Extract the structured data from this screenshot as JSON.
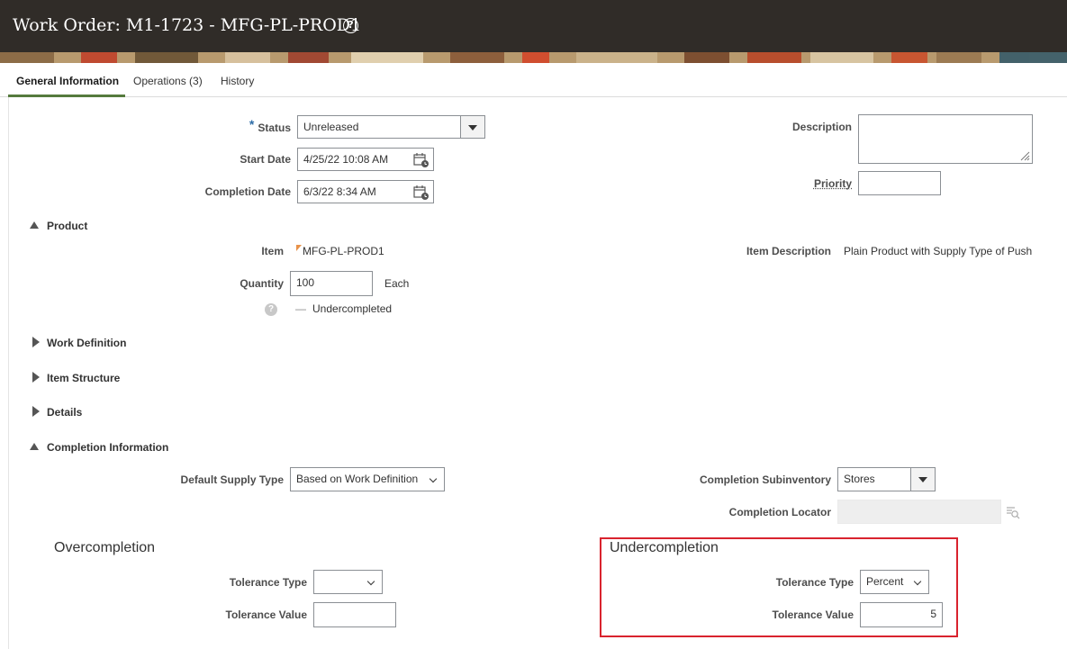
{
  "header": {
    "title": "Work Order: M1-1723 - MFG-PL-PROD1",
    "help_icon": "question-circle-icon"
  },
  "tabs": [
    {
      "label": "General Information",
      "active": true
    },
    {
      "label": "Operations (3)",
      "active": false
    },
    {
      "label": "History",
      "active": false
    }
  ],
  "general": {
    "required_mark": "*",
    "status_label": "Status",
    "status_value": "Unreleased",
    "start_date_label": "Start Date",
    "start_date_value": "4/25/22 10:08 AM",
    "completion_date_label": "Completion Date",
    "completion_date_value": "6/3/22 8:34 AM",
    "description_label": "Description",
    "description_value": "",
    "priority_label": "Priority",
    "priority_value": ""
  },
  "product": {
    "section_label": "Product",
    "item_label": "Item",
    "item_value": "MFG-PL-PROD1",
    "item_description_label": "Item Description",
    "item_description_value": "Plain Product with Supply Type of Push",
    "quantity_label": "Quantity",
    "quantity_value": "100",
    "uom": "Each",
    "undercompleted_dash": "—",
    "undercompleted_label": "Undercompleted"
  },
  "collapsed_sections": [
    "Work Definition",
    "Item Structure",
    "Details"
  ],
  "completion": {
    "section_label": "Completion Information",
    "default_supply_type_label": "Default Supply Type",
    "default_supply_type_value": "Based on Work Definition",
    "completion_subinventory_label": "Completion Subinventory",
    "completion_subinventory_value": "Stores",
    "completion_locator_label": "Completion Locator",
    "completion_locator_value": "",
    "overcompletion": {
      "heading": "Overcompletion",
      "tolerance_type_label": "Tolerance Type",
      "tolerance_type_value": "",
      "tolerance_value_label": "Tolerance Value",
      "tolerance_value": ""
    },
    "undercompletion": {
      "heading": "Undercompletion",
      "tolerance_type_label": "Tolerance Type",
      "tolerance_type_value": "Percent",
      "tolerance_value_label": "Tolerance Value",
      "tolerance_value": "5"
    }
  },
  "colors": {
    "header_bg": "#302c28",
    "tab_underline": "#557a3d",
    "highlight": "#d9232e",
    "required": "#2f6ea8"
  }
}
